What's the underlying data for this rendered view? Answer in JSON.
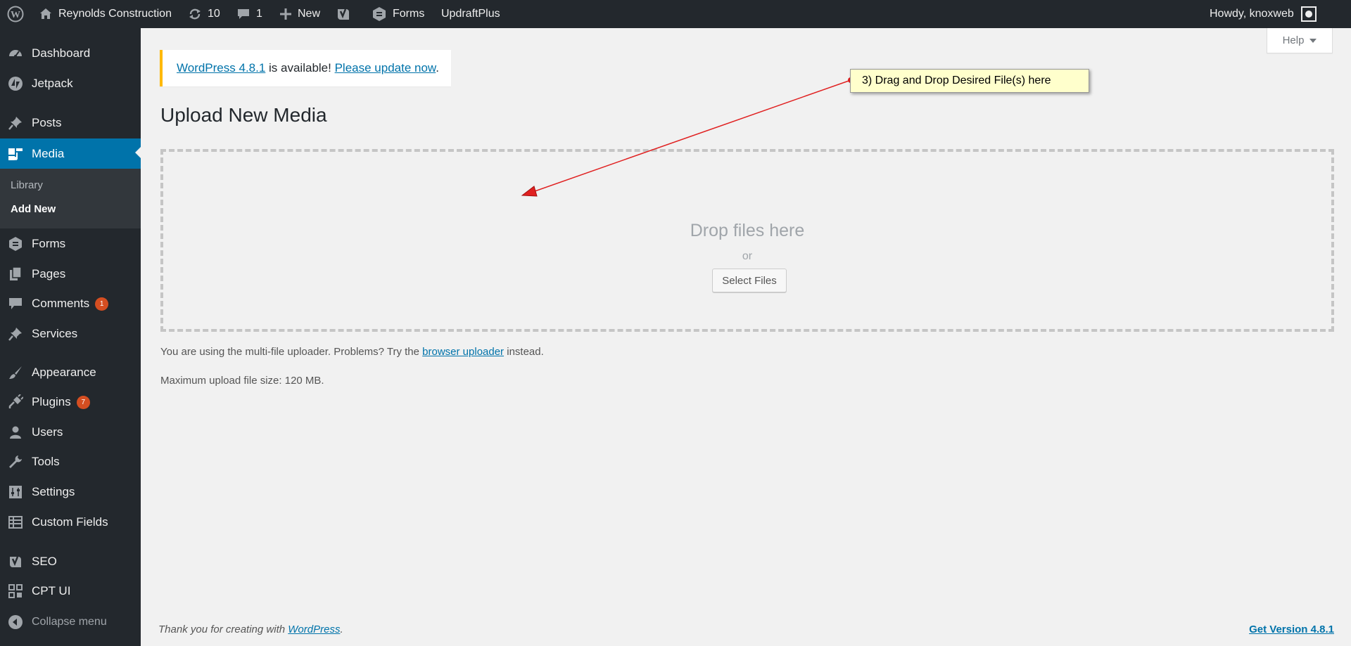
{
  "adminbar": {
    "site_name": "Reynolds Construction",
    "updates_count": "10",
    "comments_count": "1",
    "new_label": "New",
    "forms_label": "Forms",
    "updraft_label": "UpdraftPlus",
    "greeting": "Howdy, knoxweb"
  },
  "sidebar": {
    "items": [
      {
        "label": "Dashboard"
      },
      {
        "label": "Jetpack"
      },
      {
        "label": "Posts"
      },
      {
        "label": "Media"
      },
      {
        "label": "Forms"
      },
      {
        "label": "Pages"
      },
      {
        "label": "Comments",
        "badge": "1"
      },
      {
        "label": "Services"
      },
      {
        "label": "Appearance"
      },
      {
        "label": "Plugins",
        "badge": "7"
      },
      {
        "label": "Users"
      },
      {
        "label": "Tools"
      },
      {
        "label": "Settings"
      },
      {
        "label": "Custom Fields"
      },
      {
        "label": "SEO"
      },
      {
        "label": "CPT UI"
      }
    ],
    "submenu": {
      "library": "Library",
      "add_new": "Add New"
    },
    "collapse_label": "Collapse menu"
  },
  "help_tab": {
    "label": "Help"
  },
  "notice": {
    "version_link": "WordPress 4.8.1",
    "middle_text": " is available! ",
    "update_link": "Please update now",
    "end_text": "."
  },
  "page_title": "Upload New Media",
  "uploader": {
    "drop_text": "Drop files here",
    "or_text": "or",
    "select_button": "Select Files",
    "note_prefix": "You are using the multi-file uploader. Problems? Try the ",
    "note_link": "browser uploader",
    "note_suffix": " instead.",
    "max_size": "Maximum upload file size: 120 MB."
  },
  "footer": {
    "thanks_prefix": "Thank you for creating with ",
    "thanks_link": "WordPress",
    "thanks_suffix": ".",
    "version_link": "Get Version 4.8.1"
  },
  "annotation": {
    "callout_text": "3) Drag and Drop Desired File(s) here",
    "arrow_color": "#e02020"
  },
  "colors": {
    "adminbar_bg": "#23282d",
    "menu_current": "#0073aa",
    "link": "#0073aa",
    "notice_border": "#ffb900",
    "badge": "#d54e21"
  }
}
